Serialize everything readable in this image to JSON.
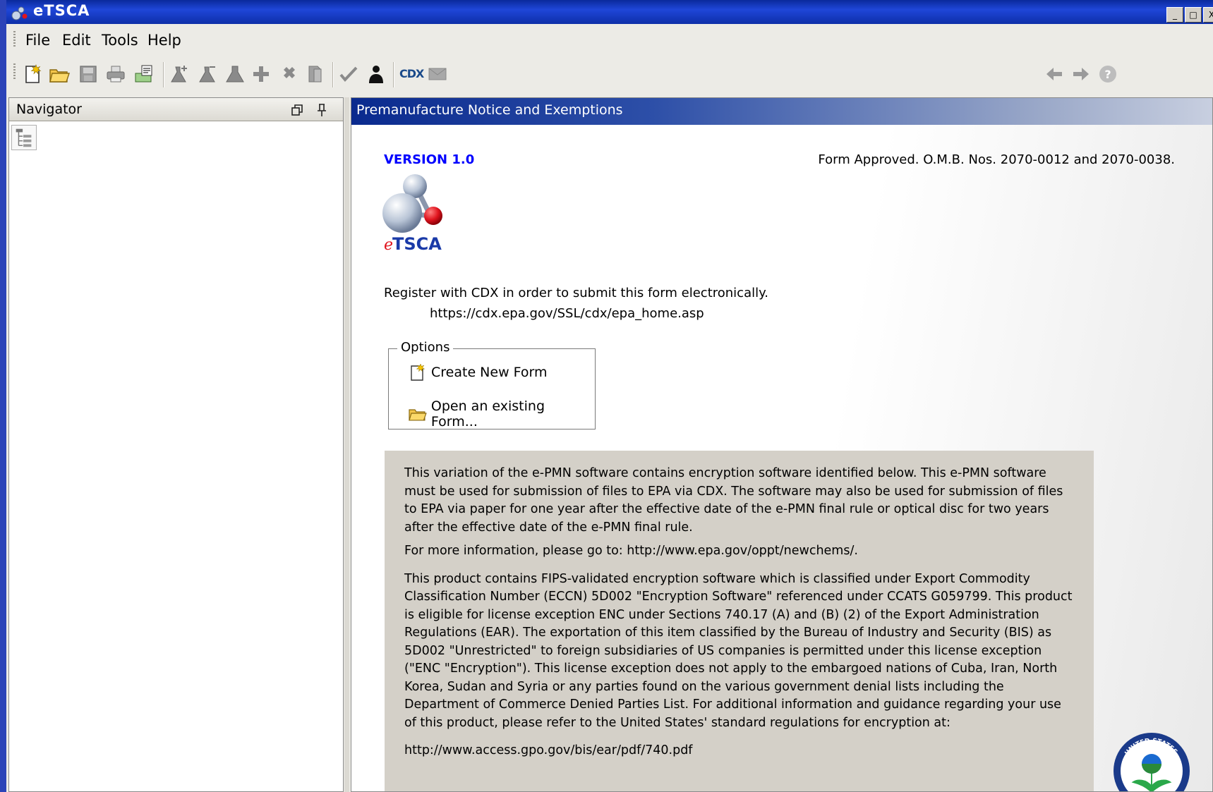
{
  "window": {
    "title": "eTSCA",
    "controls": [
      "_",
      "□",
      "X"
    ]
  },
  "menu": {
    "items": [
      "File",
      "Edit",
      "Tools",
      "Help"
    ]
  },
  "toolbar": {
    "icons": [
      "new-form-icon",
      "open-folder-icon",
      "save-icon",
      "print-icon",
      "export-icon",
      "add-chemical-icon",
      "chemical-icon",
      "flask-icon",
      "add-icon",
      "delete-icon",
      "copy-icon",
      "validate-check-icon",
      "user-icon",
      "cdx-icon",
      "mail-icon",
      "back-arrow-icon",
      "forward-arrow-icon",
      "help-icon"
    ],
    "cdx_label": "CDX"
  },
  "navigator": {
    "title": "Navigator",
    "buttons": [
      "restore-icon",
      "pin-icon"
    ]
  },
  "main": {
    "title": "Premanufacture Notice and Exemptions",
    "version": "VERSION 1.0",
    "form_approved": "Form Approved.  O.M.B. Nos. 2070-0012  and 2070-0038.",
    "logo_text_e": "e",
    "logo_text_rest": "TSCA",
    "register_text": "Register with CDX in order to submit this form electronically.",
    "cdx_url": "https://cdx.epa.gov/SSL/cdx/epa_home.asp",
    "options": {
      "legend": "Options",
      "create_label": "Create New Form",
      "open_label": "Open an existing Form..."
    },
    "info": {
      "p1": "This variation of the e-PMN software contains encryption software identified below. This e-PMN software must be used for submission of files to EPA via CDX.  The software may also be used for submission of files to EPA via paper for one year after the effective date of the e-PMN final rule  or optical disc for two years after the effective date of the e-PMN final rule.",
      "p2": "For more information, please go to: http://www.epa.gov/oppt/newchems/.",
      "p3": "This product contains FIPS-validated encryption software which is classified under Export Commodity Classification Number (ECCN) 5D002 \"Encryption Software\" referenced under CCATS G059799. This product is eligible for license exception ENC under Sections 740.17 (A) and (B) (2) of the Export Administration Regulations (EAR). The exportation of this item classified by the Bureau of Industry and Security (BIS) as 5D002 \"Unrestricted\" to foreign subsidiaries of US companies is permitted under this license exception (\"ENC \"Encryption\"). This license exception does not apply to the embargoed nations of Cuba, Iran, North Korea, Sudan and Syria or any parties found on the various government denial lists including the Department of Commerce Denied Parties List.  For additional information and guidance regarding your use of this product, please refer to the United States' standard regulations for encryption at:",
      "p4": "http://www.access.gpo.gov/bis/ear/pdf/740.pdf"
    },
    "seal_text": "UNITED STATES"
  },
  "colors": {
    "title_blue": "#1f46d8",
    "version_blue": "#0000ff",
    "info_bg": "#d4d0c8",
    "logo_red": "#e0141e"
  }
}
